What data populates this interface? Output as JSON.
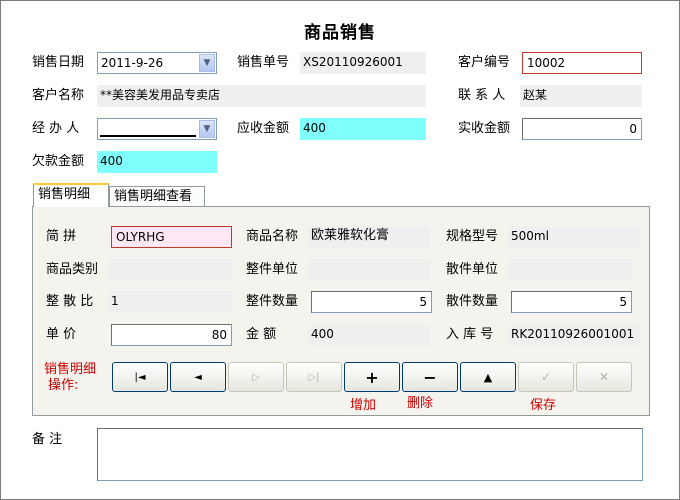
{
  "title": "商品销售",
  "header": {
    "sale_date_label": "销售日期",
    "sale_date_value": "2011-9-26",
    "sale_no_label": "销售单号",
    "sale_no_value": "XS20110926001",
    "customer_no_label": "客户编号",
    "customer_no_value": "10002",
    "customer_name_label": "客户名称",
    "customer_name_value": "**美容美发用品专卖店",
    "contact_label": "联 系 人",
    "contact_value": "赵某",
    "handler_label": "经 办 人",
    "handler_value": "",
    "receivable_label": "应收金额",
    "receivable_value": "400",
    "received_label": "实收金额",
    "received_value": "0",
    "owed_label": "欠款金额",
    "owed_value": "400"
  },
  "tabs": [
    {
      "label": "销售明细",
      "active": true
    },
    {
      "label": "销售明细查看",
      "active": false
    }
  ],
  "detail": {
    "abbr_label": "简    拼",
    "abbr_value": "OLYRHG",
    "product_name_label": "商品名称",
    "product_name_value": "欧莱雅软化膏",
    "spec_label": "规格型号",
    "spec_value": "500ml",
    "category_label": "商品类别",
    "category_value": "",
    "whole_unit_label": "整件单位",
    "whole_unit_value": "",
    "loose_unit_label": "散件单位",
    "loose_unit_value": "",
    "ratio_label": "整 散 比",
    "ratio_value": "1",
    "whole_qty_label": "整件数量",
    "whole_qty_value": "5",
    "loose_qty_label": "散件数量",
    "loose_qty_value": "5",
    "price_label": "单    价",
    "price_value": "80",
    "amount_label": "金    额",
    "amount_value": "400",
    "stock_in_label": "入 库 号",
    "stock_in_value": "RK20110926001001"
  },
  "operations": {
    "label_line1": "销售明细",
    "label_line2": "操作:",
    "add_caption": "增加",
    "delete_caption": "删除",
    "save_caption": "保存",
    "buttons": [
      {
        "name": "first",
        "glyph": "|◄"
      },
      {
        "name": "prev",
        "glyph": "◄"
      },
      {
        "name": "next",
        "glyph": "▷"
      },
      {
        "name": "last",
        "glyph": "▷|"
      },
      {
        "name": "add",
        "glyph": "+"
      },
      {
        "name": "delete",
        "glyph": "−"
      },
      {
        "name": "up",
        "glyph": "▲"
      },
      {
        "name": "save",
        "glyph": "✓"
      },
      {
        "name": "cancel",
        "glyph": "✕"
      }
    ]
  },
  "remark_label": "备    注",
  "remark_value": "",
  "colors": {
    "highlight_cyan": "#80ffff",
    "required_red": "#cc0000",
    "active_tab": "#ffc83c",
    "abbr_bg": "#ffe8f4"
  }
}
